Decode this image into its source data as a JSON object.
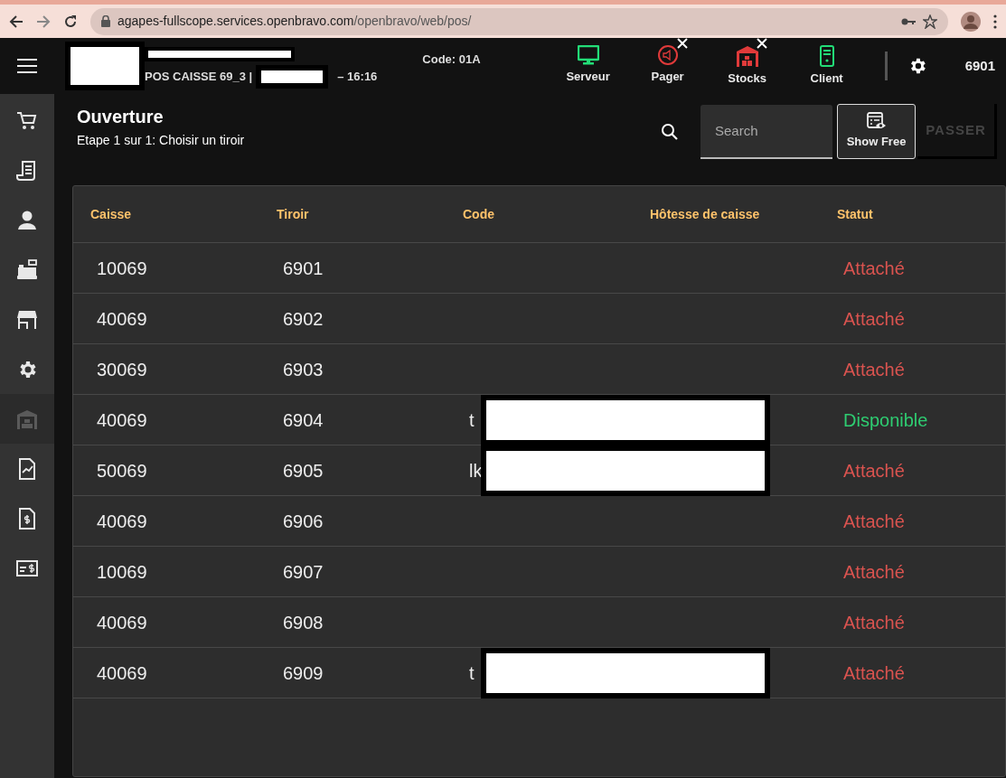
{
  "browser": {
    "url_host": "agapes-fullscope.services.openbravo.com",
    "url_path": "/openbravo/web/pos/"
  },
  "header": {
    "terminal": "POS  CAISSE 69_3 |",
    "time": "–  16:16",
    "code": "Code:  01A",
    "status_items": [
      {
        "label": "Serveur",
        "connected": true
      },
      {
        "label": "Pager",
        "connected": false
      },
      {
        "label": "Stocks",
        "connected": false
      },
      {
        "label": "Client",
        "connected": true
      }
    ],
    "drawer": "6901"
  },
  "sidebar": {
    "items": [
      {
        "disabled": false
      },
      {
        "disabled": false
      },
      {
        "disabled": false
      },
      {
        "disabled": false
      },
      {
        "disabled": false
      },
      {
        "disabled": false
      },
      {
        "disabled": true
      },
      {
        "disabled": false
      },
      {
        "disabled": false
      },
      {
        "disabled": false
      }
    ]
  },
  "page": {
    "title": "Ouverture",
    "subtitle": "Etape 1 sur 1: Choisir un tiroir"
  },
  "search": {
    "placeholder": "Search"
  },
  "buttons": [
    {
      "label": "Show Free",
      "disabled": false
    },
    {
      "label": "PASSER",
      "disabled": true
    }
  ],
  "table": {
    "columns": [
      "Caisse",
      "Tiroir",
      "Code",
      "Hôtesse de caisse",
      "Statut"
    ],
    "rows": [
      {
        "caisse": "10069",
        "tiroir": "6901",
        "code": "",
        "redacted": false,
        "status": "Attaché",
        "color": "#d9534f"
      },
      {
        "caisse": "40069",
        "tiroir": "6902",
        "code": "",
        "redacted": false,
        "status": "Attaché",
        "color": "#d9534f"
      },
      {
        "caisse": "30069",
        "tiroir": "6903",
        "code": "",
        "redacted": false,
        "status": "Attaché",
        "color": "#d9534f"
      },
      {
        "caisse": "40069",
        "tiroir": "6904",
        "code": "t",
        "redacted": true,
        "status": "Disponible",
        "color": "#2ecc71"
      },
      {
        "caisse": "50069",
        "tiroir": "6905",
        "code": "lk",
        "redacted": true,
        "status": "Attaché",
        "color": "#d9534f"
      },
      {
        "caisse": "40069",
        "tiroir": "6906",
        "code": "",
        "redacted": false,
        "status": "Attaché",
        "color": "#d9534f"
      },
      {
        "caisse": "10069",
        "tiroir": "6907",
        "code": "",
        "redacted": false,
        "status": "Attaché",
        "color": "#d9534f"
      },
      {
        "caisse": "40069",
        "tiroir": "6908",
        "code": "",
        "redacted": false,
        "status": "Attaché",
        "color": "#d9534f"
      },
      {
        "caisse": "40069",
        "tiroir": "6909",
        "code": "t",
        "redacted": true,
        "status": "Attaché",
        "color": "#d9534f"
      }
    ]
  }
}
